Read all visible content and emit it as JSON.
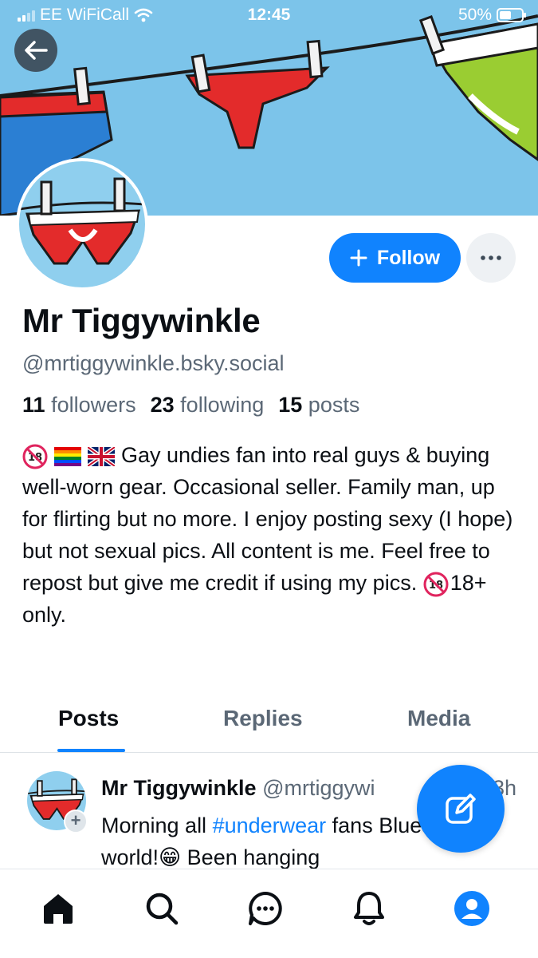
{
  "status_bar": {
    "carrier": "EE WiFiCall",
    "time": "12:45",
    "battery": "50%"
  },
  "profile": {
    "name": "Mr Tiggywinkle",
    "handle": "@mrtiggywinkle.bsky.social",
    "stats": {
      "followers_count": "11",
      "followers_label": "followers",
      "following_count": "23",
      "following_label": "following",
      "posts_count": "15",
      "posts_label": "posts"
    },
    "bio_line1": "Gay undies fan into real guys &",
    "bio_rest": "buying well-worn gear. Occasional seller. Family man, up for flirting but no more. I enjoy posting sexy (I hope) but not sexual pics. All content is me. Feel free to repost but give me credit if using my pics.",
    "bio_end": "18+ only.",
    "follow_label": "Follow"
  },
  "tabs": [
    {
      "label": "Posts",
      "active": true
    },
    {
      "label": "Replies",
      "active": false
    },
    {
      "label": "Media",
      "active": false
    }
  ],
  "post": {
    "author_name": "Mr Tiggywinkle",
    "author_handle": "@mrtiggywi",
    "time": "3h",
    "text_before": "Morning all ",
    "hashtag": "#underwear",
    "text_after": " fans Bluesky world!😁 Been hanging"
  },
  "nav": [
    "home-icon",
    "search-icon",
    "chat-icon",
    "bell-icon",
    "profile-icon"
  ],
  "colors": {
    "accent": "#1083fe",
    "banner_sky": "#7cc4ea",
    "muted_text": "#5b6876"
  }
}
